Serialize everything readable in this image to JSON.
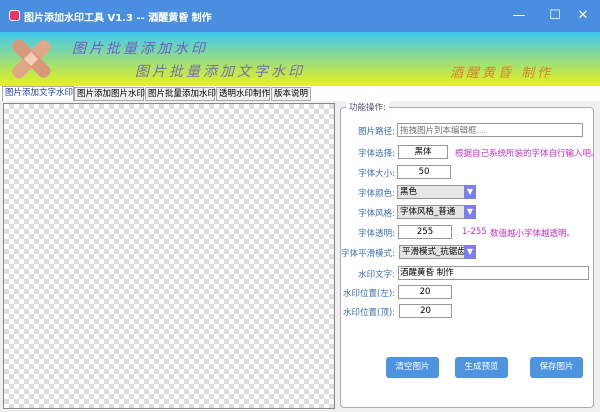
{
  "window": {
    "title": "图片添加水印工具 V1.3 -- 酒醒黄昏 制作",
    "minimize": "—",
    "maximize": "☐",
    "close": "✕"
  },
  "banner": {
    "line1": "图片批量添加水印",
    "line2": "图片批量添加文字水印",
    "author": "酒醒黄昏 制作",
    "logo_icon": "bandage-icon"
  },
  "tabs": [
    {
      "label": "图片添加文字水印",
      "active": true
    },
    {
      "label": "图片添加图片水印"
    },
    {
      "label": "图片批量添加水印"
    },
    {
      "label": "透明水印制作"
    },
    {
      "label": "版本说明"
    }
  ],
  "panel": {
    "title": "功能操作:",
    "path_label": "图片路径:",
    "path_placeholder": "拖拽图片到本编辑框....",
    "font_label": "字体选择:",
    "font_value": "黑体",
    "font_hint": "根据自己系统所装的字体自行输入吧。",
    "size_label": "字体大小:",
    "size_value": "50",
    "color_label": "字体颜色:",
    "color_value": "黑色",
    "style_label": "字体风格:",
    "style_value": "字体风格_普通",
    "alpha_label": "字体透明:",
    "alpha_value": "255",
    "alpha_range": "1-255",
    "alpha_hint": "数值越小字体越透明。",
    "smooth_label": "字体平滑模式:",
    "smooth_value": "平滑模式_抗锯齿",
    "text_label": "水印文字:",
    "text_value": "酒醒黄昏 制作",
    "left_label": "水印位置(左):",
    "left_value": "20",
    "top_label": "水印位置(顶):",
    "top_value": "20",
    "buttons": {
      "clear": "清空图片",
      "preview": "生成预览",
      "save": "保存图片"
    }
  },
  "colors": {
    "titlebar": "#4a8fdf",
    "button": "#4d93df",
    "hint": "#c02fc0",
    "label": "#3b6fb0"
  }
}
